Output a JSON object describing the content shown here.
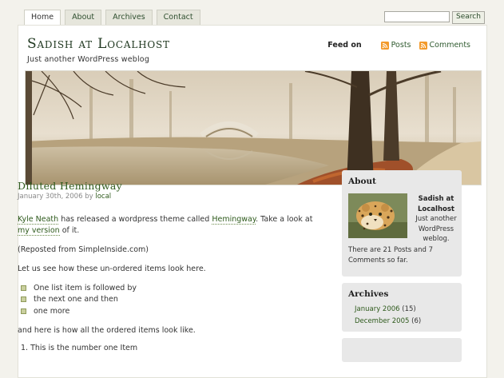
{
  "nav": {
    "tabs": [
      {
        "label": "Home",
        "active": true
      },
      {
        "label": "About",
        "active": false
      },
      {
        "label": "Archives",
        "active": false
      },
      {
        "label": "Contact",
        "active": false
      }
    ]
  },
  "search": {
    "value": "",
    "button_label": "Search"
  },
  "site": {
    "title": "Sadish at Localhost",
    "tagline": "Just another WordPress weblog"
  },
  "feed": {
    "label": "Feed on",
    "posts_label": "Posts",
    "comments_label": "Comments",
    "icon": "rss-icon"
  },
  "post": {
    "title": "Diluted Hemingway",
    "date": "January 30th, 2006",
    "by": "by",
    "author": "local",
    "para1": {
      "link1": "Kyle Neath",
      "text1": " has released a wordpress theme called ",
      "link2": "Hemingway",
      "text2": ". Take a look at ",
      "link3": "my version",
      "text3": " of it."
    },
    "para2": "(Reposted from SimpleInside.com)",
    "para3": "Let us see how these un-ordered items look here.",
    "ul_items": [
      "One list item is followed by",
      "the next one and then",
      "one more"
    ],
    "para4": "and here is how all the ordered items look like.",
    "ol_first": "1.  This is the number one Item"
  },
  "sidebar": {
    "about": {
      "title": "About",
      "name": "Sadish at Localhost",
      "text": "Just another WordPress weblog.",
      "foot": "There are 21 Posts and 7 Comments so far.",
      "image": "leopard-photo"
    },
    "archives": {
      "title": "Archives",
      "items": [
        {
          "label": "January 2006",
          "count": "(15)"
        },
        {
          "label": "December 2005",
          "count": "(6)"
        }
      ]
    }
  },
  "colors": {
    "accent": "#2e5a1c",
    "page_bg": "#f3f2ec",
    "sidebar_bg": "#e8e8e8",
    "rss": "#f39a2b"
  }
}
